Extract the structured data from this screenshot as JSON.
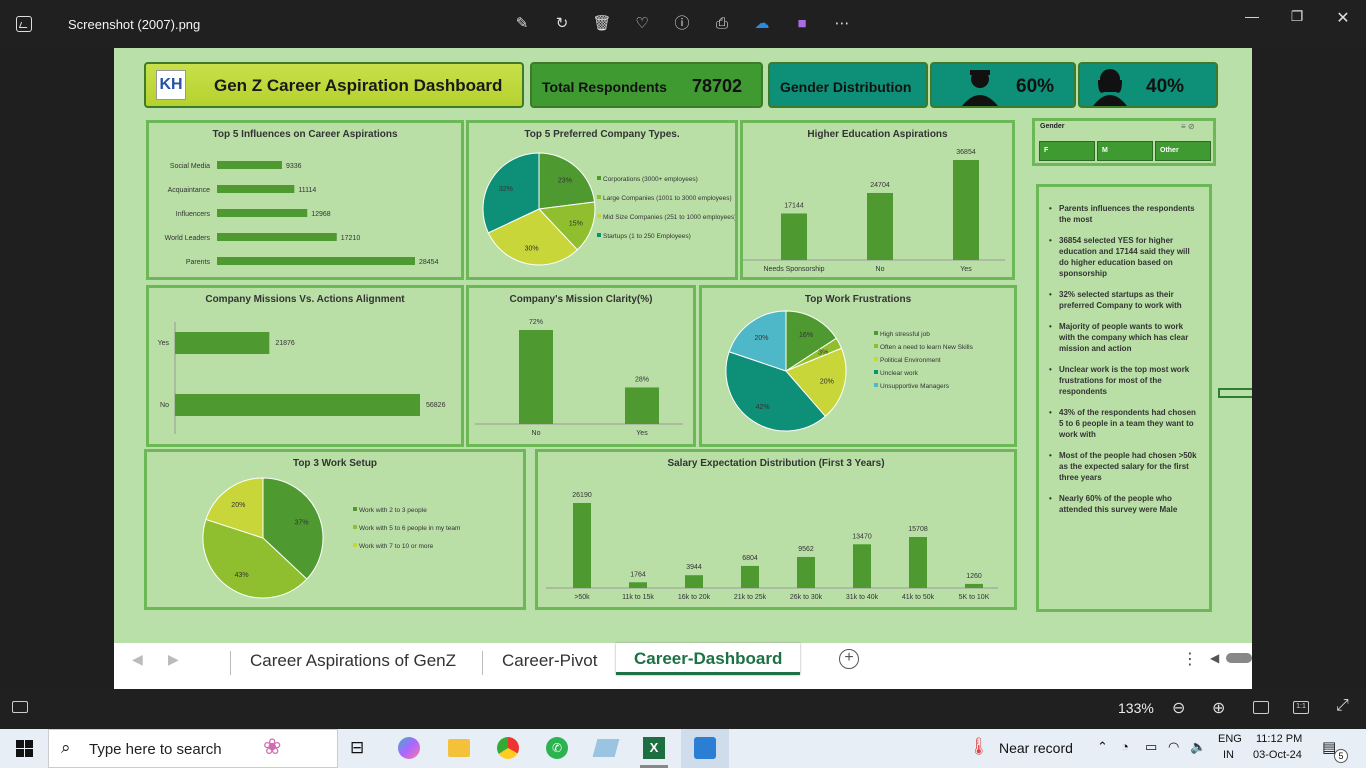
{
  "window": {
    "filename": "Screenshot (2007).png"
  },
  "header": {
    "title": "Gen Z Career Aspiration Dashboard",
    "logo_text": "KH",
    "respondents_label": "Total Respondents",
    "respondents_value": "78702",
    "gender_label": "Gender Distribution",
    "male_pct": "60%",
    "female_pct": "40%"
  },
  "slicer": {
    "title": "Gender",
    "options": [
      "F",
      "M",
      "Other"
    ]
  },
  "influences": {
    "title": "Top 5 Influences on Career Aspirations",
    "chart_data": {
      "type": "bar",
      "categories": [
        "Social Media",
        "Acquaintance",
        "Influencers",
        "World Leaders",
        "Parents"
      ],
      "values": [
        9336,
        11114,
        12968,
        17210,
        28454
      ]
    }
  },
  "company_types": {
    "title": "Top 5 Preferred Company Types.",
    "chart_data": {
      "type": "pie",
      "labels": [
        "Corporations (3000+ employees)",
        "Large Companies (1001 to 3000 employees)",
        "Mid Size Companies (251 to 1000 employees)",
        "Startups (1 to 250 Employees)"
      ],
      "values": [
        23,
        15,
        30,
        32
      ],
      "display": [
        "23%",
        "15%",
        "30%",
        "32%"
      ]
    }
  },
  "higher_ed": {
    "title": "Higher Education Aspirations",
    "chart_data": {
      "type": "bar",
      "categories": [
        "Needs Sponsorship",
        "No",
        "Yes"
      ],
      "values": [
        17144,
        24704,
        36854
      ]
    }
  },
  "missions": {
    "title": "Company Missions Vs. Actions Alignment",
    "chart_data": {
      "type": "bar",
      "categories": [
        "Yes",
        "No"
      ],
      "values": [
        21876,
        56826
      ]
    }
  },
  "clarity": {
    "title": "Company's Mission Clarity(%)",
    "chart_data": {
      "type": "bar",
      "categories": [
        "No",
        "Yes"
      ],
      "values": [
        72,
        28
      ],
      "display": [
        "72%",
        "28%"
      ]
    }
  },
  "frustrations": {
    "title": "Top Work Frustrations",
    "chart_data": {
      "type": "pie",
      "labels": [
        "High stressful job",
        "Often a need to learn New Skills",
        "Political Environment",
        "Unclear work",
        "Unsupportive Managers"
      ],
      "values": [
        16,
        3,
        20,
        42,
        20
      ],
      "display": [
        "16%",
        "3%",
        "20%",
        "42%",
        "20%"
      ]
    }
  },
  "setup": {
    "title": "Top 3 Work Setup",
    "chart_data": {
      "type": "pie",
      "labels": [
        "Work with 2 to 3 people",
        "Work with 5 to 6 people in my team",
        "Work with 7 to 10 or more"
      ],
      "values": [
        37,
        43,
        20
      ],
      "display": [
        "37%",
        "43%",
        "20%"
      ]
    }
  },
  "salary": {
    "title": "Salary Expectation Distribution (First 3 Years)",
    "chart_data": {
      "type": "bar",
      "categories": [
        ">50k",
        "11k to 15k",
        "16k to 20k",
        "21k to 25k",
        "26k to 30k",
        "31k to 40k",
        "41k to 50k",
        "5K to 10K"
      ],
      "values": [
        26190,
        1764,
        3944,
        6804,
        9562,
        13470,
        15708,
        1260
      ]
    }
  },
  "notes": [
    "Parents influences the respondents the most",
    "36854 selected YES for higher education and 17144 said they will do higher education based on sponsorship",
    "32% selected startups as their preferred Company to work with",
    "Majority of people wants to work with the company which has clear mission and action",
    "Unclear work is the top most work frustrations for most of the respondents",
    "43% of the respondents had chosen 5 to 6 people in a team they want to work with",
    "Most of the people had chosen >50k as the expected salary for the first three years",
    "Nearly 60% of the people who attended this survey were Male"
  ],
  "tabs": [
    "Career Aspirations of GenZ",
    "Career-Pivot",
    "Career-Dashboard"
  ],
  "status": {
    "zoom": "133%"
  },
  "taskbar": {
    "search": "Type here to search",
    "weather": "Near record",
    "lang1": "ENG",
    "lang2": "IN",
    "time": "11:12 PM",
    "date": "03-Oct-24",
    "notif": "5"
  },
  "colors": {
    "dark": "#4e9a30",
    "olive": "#8fbf2e",
    "lime": "#c8d63a",
    "teal": "#0e8f77",
    "cyan": "#4fb8c8"
  }
}
